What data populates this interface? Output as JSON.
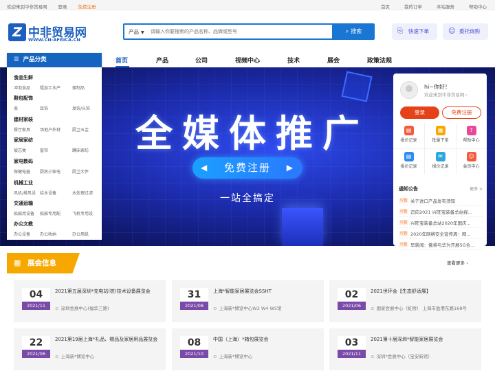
{
  "topbar": {
    "welcome": "欢迎来到中非贸易网",
    "login": "登录",
    "register": "免费注册",
    "right_links": [
      "首页",
      "我的订单",
      "本站服务",
      "帮助中心"
    ]
  },
  "logo": {
    "mark": "Z",
    "name_cn": "中非贸易网",
    "domain": "WWW.CN-AFRICA.CN"
  },
  "search": {
    "category": "产品",
    "placeholder": "请输入你要搜索的产品名称、品牌或型号",
    "button": "搜索"
  },
  "header_buttons": {
    "quick_order": "快速下单",
    "entrust": "委托询购"
  },
  "category_panel": {
    "title": "产品分类",
    "groups": [
      {
        "title": "食品生鲜",
        "subs": [
          "冲泡食品",
          "粗加工水产",
          "蛋制品"
        ]
      },
      {
        "title": "鞋包配饰",
        "subs": [
          "表",
          "耳饰",
          "发饰/头饰"
        ]
      },
      {
        "title": "建材家装",
        "subs": [
          "餐厅家具",
          "场地户外材",
          "厨卫五金"
        ]
      },
      {
        "title": "家居家纺",
        "subs": [
          "被芯类",
          "窗帘",
          "蹲床家纺"
        ]
      },
      {
        "title": "家电数码",
        "subs": [
          "保健电器",
          "厨房小家电",
          "厨卫大件"
        ]
      },
      {
        "title": "机械工业",
        "subs": [
          "风机/排风设",
          "给水设备",
          "水处理过滤"
        ]
      },
      {
        "title": "交通运输",
        "subs": [
          "船舶用设备",
          "船舶专用配",
          "飞机专用设"
        ]
      },
      {
        "title": "办公文教",
        "subs": [
          "办公设备",
          "办公收纳",
          "办公用纸"
        ]
      }
    ]
  },
  "nav": {
    "items": [
      "首页",
      "产品",
      "公司",
      "视频中心",
      "技术",
      "展会",
      "政策法规"
    ],
    "active": 0
  },
  "banner": {
    "headline": "全媒体推广",
    "cta": "免费注册",
    "subtitle": "一站全搞定"
  },
  "user_box": {
    "greeting": "hi~你好！",
    "welcome": "欢迎来到中非贸易网~",
    "login": "登录",
    "register": "免费注册",
    "quick_links": [
      {
        "label": "报价记录",
        "icon": "file-icon",
        "color": "#f25b3d"
      },
      {
        "label": "批量下单",
        "icon": "cart-icon",
        "color": "#f7a800"
      },
      {
        "label": "帮助中心",
        "icon": "help-icon",
        "color": "#e8489a"
      },
      {
        "label": "报价记录",
        "icon": "doc-icon",
        "color": "#2c8cf0"
      },
      {
        "label": "报价记录",
        "icon": "chat-icon",
        "color": "#2ba6e0"
      },
      {
        "label": "会员中心",
        "icon": "user-icon",
        "color": "#f25b3d"
      }
    ],
    "notice": {
      "title": "通知公告",
      "more": "更多 >",
      "tag": "公告",
      "items": [
        "关于进口产品发布须知",
        "迈向2021 兴旺宝装备总站视...",
        "兴旺宝装备总站2020年国庆...",
        "2020年网络安全宣传周：网...",
        "早新闻：俄将与华为开展5G合..."
      ]
    }
  },
  "exhibition": {
    "title": "展会信息",
    "more": "查看更多",
    "cards": [
      {
        "day": "04",
        "ym": "2021/11",
        "title": "2021第五届深圳*充电站(桩)技术设备展览会",
        "location": "深圳会展中心(福华三路)"
      },
      {
        "day": "31",
        "ym": "2021/08",
        "title": "上海*智能家居展览会SSHT",
        "location": "上海新*博览中心W3 W4 W5馆"
      },
      {
        "day": "02",
        "ym": "2021/06",
        "title": "2021世环会【生态舒适展】",
        "location": "国家会展中心（虹桥） 上海市盈港东路168号"
      },
      {
        "day": "22",
        "ym": "2021/06",
        "title": "2021第19届上海*礼品、赠品及家居用品展览会",
        "location": "上海新*博览中心"
      },
      {
        "day": "08",
        "ym": "2021/10",
        "title": "中国（上海）*箱包展览会",
        "location": "上海新*博览中心"
      },
      {
        "day": "03",
        "ym": "2021/11",
        "title": "2021第十届深圳*智能家居展览会",
        "location": "深圳*会展中心（宝安新馆）"
      }
    ]
  }
}
